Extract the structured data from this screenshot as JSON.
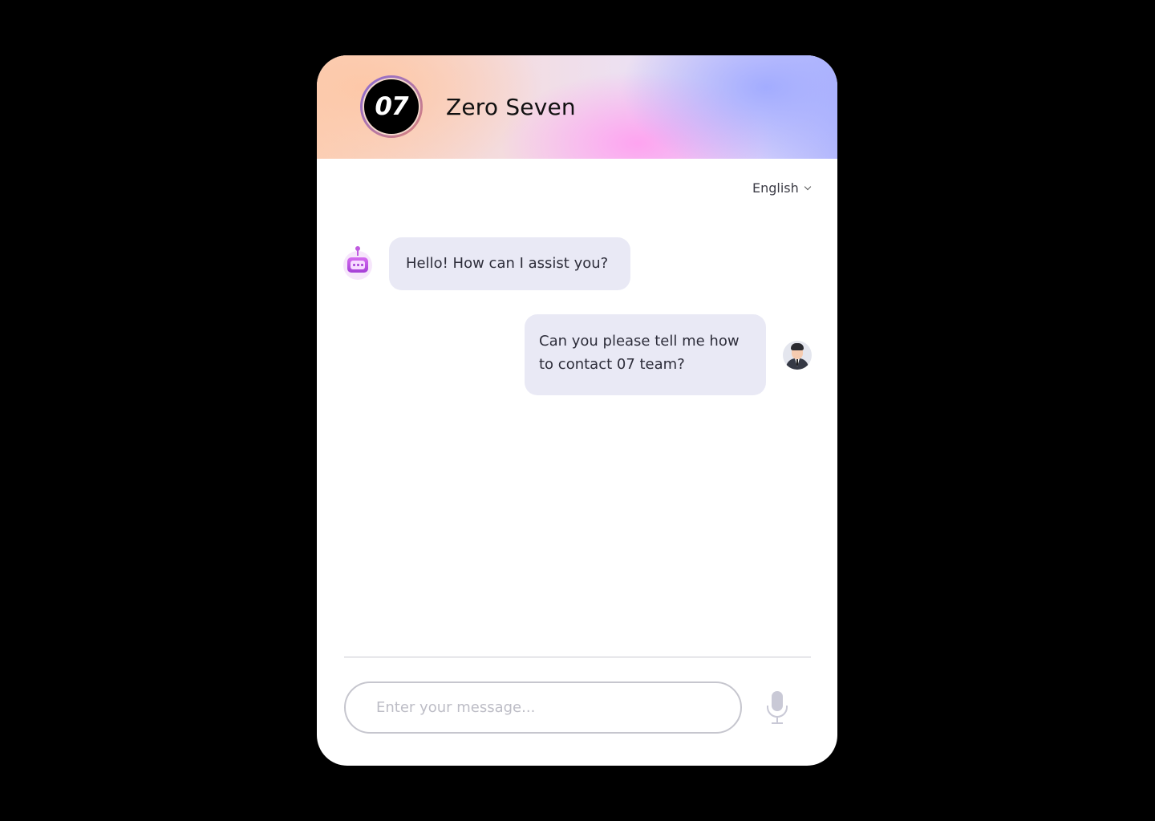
{
  "header": {
    "logo_text": "07",
    "brand_name": "Zero Seven"
  },
  "language": {
    "selected": "English"
  },
  "messages": [
    {
      "sender": "bot",
      "text": "Hello! How can I assist you?"
    },
    {
      "sender": "user",
      "text": "Can you please tell me how to contact 07 team?"
    }
  ],
  "composer": {
    "placeholder": "Enter your message...",
    "value": ""
  },
  "icons": {
    "bot_avatar": "robot-chat-icon",
    "user_avatar": "businessman-avatar",
    "mic": "microphone-icon",
    "language_chevron": "chevron-down-icon"
  },
  "colors": {
    "background": "#000000",
    "panel": "#ffffff",
    "bubble": "#e9e9f5",
    "bot_accent": "#c05be0",
    "gradient_peach": "#fbd0b7",
    "gradient_pink": "#ffa0f0",
    "gradient_blue": "#a0aaff"
  }
}
